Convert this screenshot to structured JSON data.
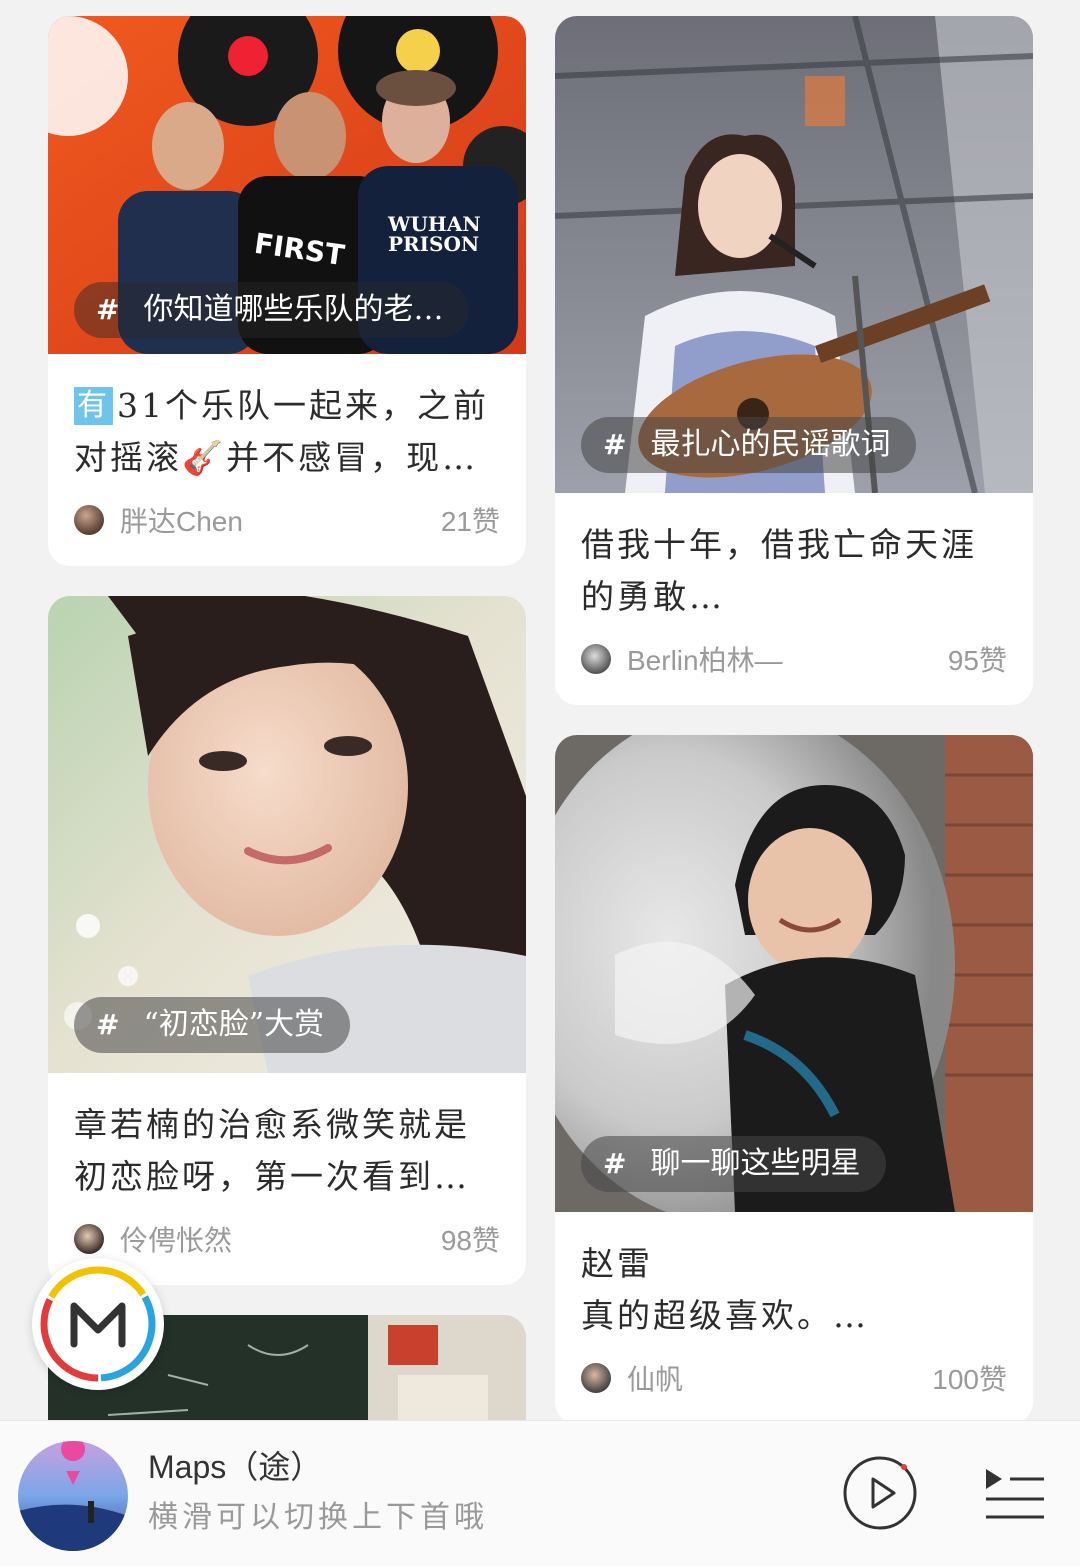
{
  "feed": {
    "left_column": [
      {
        "topic": "你知道哪些乐队的老…",
        "tag": "有",
        "text": "31个乐队一起来，之前对摇滚🎸并不感冒，现…",
        "author": "胖达Chen",
        "likes": "21赞"
      },
      {
        "topic": "“初恋脸”大赏",
        "text": "章若楠的治愈系微笑就是初恋脸呀，第一次看到…",
        "author": "伶俜怅然",
        "likes": "98赞"
      }
    ],
    "right_column": [
      {
        "topic": "最扎心的民谣歌词",
        "text": "借我十年，借我亡命天涯的勇敢…",
        "author": "Berlin柏林—",
        "likes": "95赞"
      },
      {
        "topic": "聊一聊这些明星",
        "text_line1": "赵雷",
        "text_line2": "真的超级喜欢。…",
        "author": "仙帆",
        "likes": "100赞"
      }
    ]
  },
  "float_badge": {
    "icon": "m-logo-icon",
    "colors": [
      "#f2c200",
      "#2aa4e0",
      "#e23b3b"
    ]
  },
  "player": {
    "song_title": "Maps（途）",
    "hint": "横滑可以切换上下首哦",
    "play_icon": "play-icon",
    "playlist_icon": "playlist-icon"
  },
  "colors": {
    "accent_tag": "#6ec4ea",
    "meta_gray": "#9a9a9a",
    "background": "#f2f2f2"
  }
}
